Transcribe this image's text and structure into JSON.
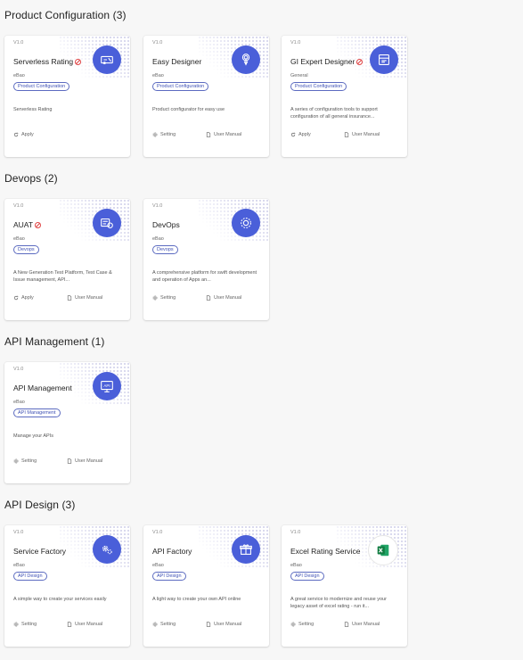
{
  "sections": [
    {
      "title": "Product Configuration (3)",
      "cards": [
        {
          "version": "V1.0",
          "name": "Serverless Rating",
          "vendor": "eBao",
          "tag": "Product Configuration",
          "description": "Serverless Rating",
          "action1": "Apply",
          "action2": "",
          "icon": "rating-icon",
          "disabled": true
        },
        {
          "version": "V1.0",
          "name": "Easy Designer",
          "vendor": "eBao",
          "tag": "Product Configuration",
          "description": "Product configurator for easy use",
          "action1": "Setting",
          "action2": "User Manual",
          "icon": "touch-icon",
          "disabled": false
        },
        {
          "version": "V1.0",
          "name": "GI Expert Designer",
          "vendor": "General",
          "tag": "Product Configuration",
          "description": "A series of configuration tools to support configuration of all general insurance...",
          "action1": "Apply",
          "action2": "User Manual",
          "icon": "window-icon",
          "disabled": true
        }
      ]
    },
    {
      "title": "Devops (2)",
      "cards": [
        {
          "version": "V1.0",
          "name": "AUAT",
          "vendor": "eBao",
          "tag": "Devops",
          "description": "A New Generation Test Platform, Test Case & Issue management, API...",
          "action1": "Apply",
          "action2": "User Manual",
          "icon": "test-icon",
          "disabled": true
        },
        {
          "version": "V1.0",
          "name": "DevOps",
          "vendor": "eBao",
          "tag": "Devops",
          "description": "A comprehensive platform for swift development and operation of Apps an...",
          "action1": "Setting",
          "action2": "User Manual",
          "icon": "cog-icon",
          "disabled": false
        }
      ]
    },
    {
      "title": "API Management (1)",
      "cards": [
        {
          "version": "V1.0",
          "name": "API Management",
          "vendor": "eBao",
          "tag": "API Management",
          "description": "Manage your APIs",
          "action1": "Setting",
          "action2": "User Manual",
          "icon": "api-icon",
          "disabled": false
        }
      ]
    },
    {
      "title": "API Design (3)",
      "cards": [
        {
          "version": "V1.0",
          "name": "Service Factory",
          "vendor": "eBao",
          "tag": "API Design",
          "description": "A simple way to create your services easily",
          "action1": "Setting",
          "action2": "User Manual",
          "icon": "gears-icon",
          "disabled": false
        },
        {
          "version": "V1.0",
          "name": "API Factory",
          "vendor": "eBao",
          "tag": "API Design",
          "description": "A light way to create your own API online",
          "action1": "Setting",
          "action2": "User Manual",
          "icon": "gift-icon",
          "disabled": false
        },
        {
          "version": "V1.0",
          "name": "Excel Rating Service",
          "vendor": "eBao",
          "tag": "API Design",
          "description": "A great service to modernize and reuse your legacy asset of excel rating - run it...",
          "action1": "Setting",
          "action2": "User Manual",
          "icon": "excel-icon",
          "disabled": false
        }
      ]
    }
  ]
}
